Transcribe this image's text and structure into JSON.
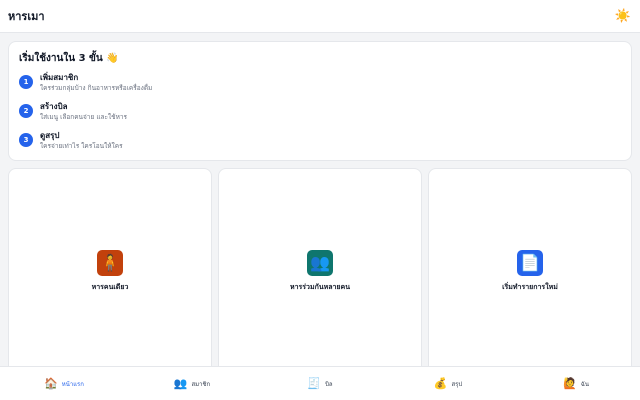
{
  "header": {
    "title": "หารเมา",
    "theme_icon": "☀️"
  },
  "onboarding": {
    "title": "เริ่มใช้งานใน 3 ขั้น 👋",
    "steps": [
      {
        "number": "1",
        "title": "เพิ่มสมาชิก",
        "desc": "ใครร่วมกลุ่มบ้าง กินอาหารหรือเครื่องดื่ม"
      },
      {
        "number": "2",
        "title": "สร้างบิล",
        "desc": "ใส่เมนู เลือกคนจ่าย และใช้หาร"
      },
      {
        "number": "3",
        "title": "ดูสรุป",
        "desc": "ใครจ่ายเท่าไร ใครโอนให้ใคร"
      }
    ]
  },
  "actions": [
    {
      "label": "หารคนเดียว",
      "icon": "🧍",
      "color": "#c2410c"
    },
    {
      "label": "หารร่วมกันหลายคน",
      "icon": "👥",
      "color": "#0f766e"
    },
    {
      "label": "เริ่มทำรายการใหม่",
      "icon": "📄",
      "color": "#2563eb"
    }
  ],
  "nav": [
    {
      "label": "หน้าแรก",
      "icon": "🏠",
      "active": true
    },
    {
      "label": "สมาชิก",
      "icon": "👥",
      "active": false
    },
    {
      "label": "บิล",
      "icon": "🧾",
      "active": false
    },
    {
      "label": "สรุป",
      "icon": "💰",
      "active": false
    },
    {
      "label": "ฉัน",
      "icon": "🙋",
      "active": false
    }
  ]
}
